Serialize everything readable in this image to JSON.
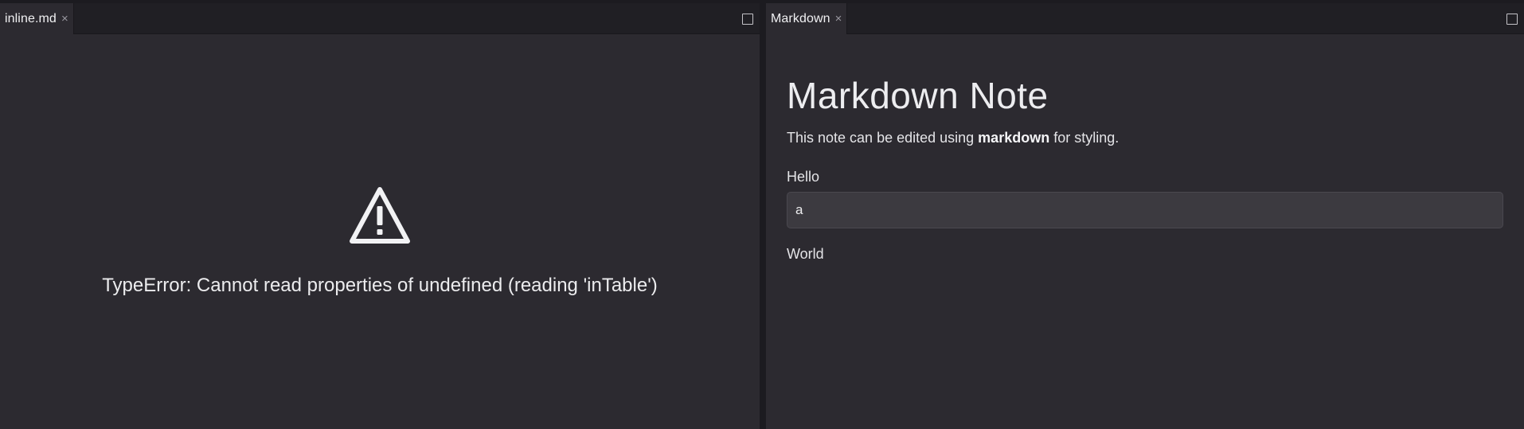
{
  "left_pane": {
    "tab_label": "inline.md",
    "close_glyph": "×",
    "error_message": "TypeError: Cannot read properties of undefined (reading 'inTable')",
    "icon": "warning-triangle-icon"
  },
  "right_pane": {
    "tab_label": "Markdown",
    "close_glyph": "×",
    "heading": "Markdown Note",
    "paragraph_before": "This note can be edited using ",
    "paragraph_bold": "markdown",
    "paragraph_after": " for styling.",
    "field_label": "Hello",
    "field_value": "a",
    "trailing_text": "World"
  },
  "colors": {
    "background": "#1c1b20",
    "pane": "#2c2a30",
    "tabbar": "#201f24",
    "input": "#3c3a40"
  }
}
